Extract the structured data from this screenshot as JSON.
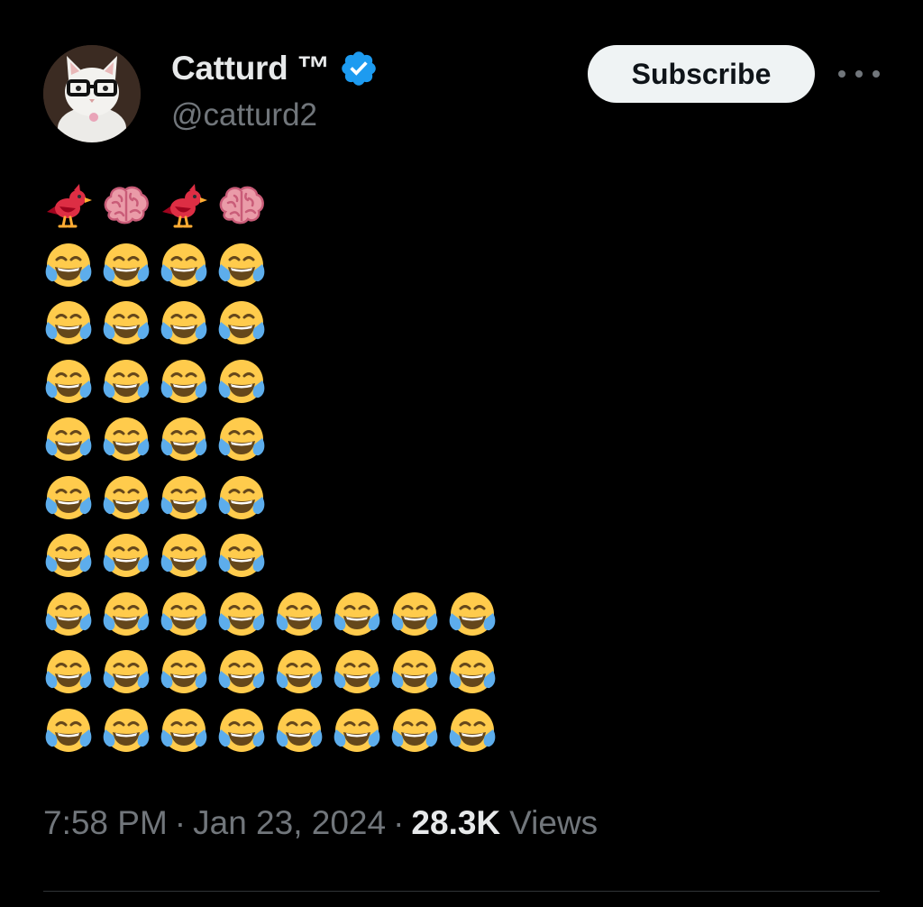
{
  "tweet": {
    "author_name": "Catturd ™",
    "handle": "@catturd2",
    "subscribe_label": "Subscribe",
    "verified_color": "#1d9bf0",
    "emoji_rows": [
      [
        "bird",
        "brain",
        "bird",
        "brain"
      ],
      [
        "joy",
        "joy",
        "joy",
        "joy"
      ],
      [
        "joy",
        "joy",
        "joy",
        "joy"
      ],
      [
        "joy",
        "joy",
        "joy",
        "joy"
      ],
      [
        "joy",
        "joy",
        "joy",
        "joy"
      ],
      [
        "joy",
        "joy",
        "joy",
        "joy"
      ],
      [
        "joy",
        "joy",
        "joy",
        "joy"
      ],
      [
        "joy",
        "joy",
        "joy",
        "joy",
        "joy",
        "joy",
        "joy",
        "joy"
      ],
      [
        "joy",
        "joy",
        "joy",
        "joy",
        "joy",
        "joy",
        "joy",
        "joy"
      ],
      [
        "joy",
        "joy",
        "joy",
        "joy",
        "joy",
        "joy",
        "joy",
        "joy"
      ]
    ],
    "time": "7:58 PM",
    "date": "Jan 23, 2024",
    "views_count": "28.3K",
    "views_label": "Views"
  }
}
